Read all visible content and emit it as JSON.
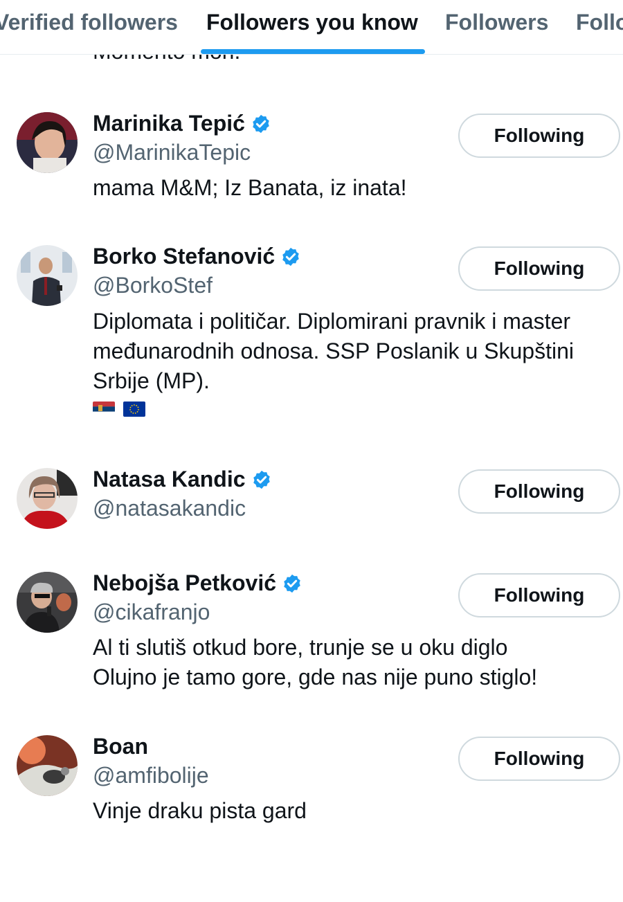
{
  "tabs": [
    {
      "label": "Verified followers",
      "active": false
    },
    {
      "label": "Followers you know",
      "active": true
    },
    {
      "label": "Followers",
      "active": false
    },
    {
      "label": "Following",
      "active": false
    }
  ],
  "partial_bio_above": "Momento mori.",
  "users": [
    {
      "name": "Marinika Tepić",
      "verified": true,
      "handle": "@MarinikaTepic",
      "bio": "mama M&M; Iz Banata, iz inata!",
      "button": "Following"
    },
    {
      "name": "Borko Stefanović",
      "verified": true,
      "handle": "@BorkoStef",
      "bio": "Diplomata i političar. Diplomirani pravnik i master\nmeđunarodnih odnosa. SSP Poslanik u Skupštini\nSrbije (MP).",
      "bio_flags": [
        "serbia-flag-icon",
        "eu-flag-icon"
      ],
      "button": "Following"
    },
    {
      "name": "Natasa Kandic",
      "verified": true,
      "handle": "@natasakandic",
      "bio": "",
      "button": "Following"
    },
    {
      "name": "Nebojša Petković",
      "verified": true,
      "handle": "@cikafranjo",
      "bio": "Al ti slutiš otkud bore, trunje se u oku diglo\nOlujno je tamo gore, gde nas nije puno stiglo!",
      "button": "Following"
    },
    {
      "name": "Boan",
      "verified": false,
      "handle": "@amfibolije",
      "bio": "Vinje draku pista gard",
      "button": "Following"
    }
  ],
  "colors": {
    "accent": "#1d9bf0",
    "text": "#0f1419",
    "secondary": "#536471",
    "border": "#cfd9de"
  }
}
